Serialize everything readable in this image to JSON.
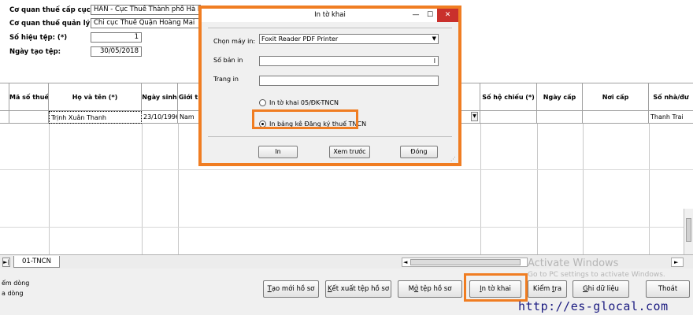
{
  "header": {
    "co_quan_cap_cuc_label": "Cơ quan thuế cấp cục:",
    "co_quan_cap_cuc_value": "HAN - Cục Thuế Thành phố Hà Nội",
    "co_quan_quan_ly_label": "Cơ quan thuế quản lý: (*)",
    "co_quan_quan_ly_value": "Chi cục Thuế Quận Hoàng Mai",
    "so_hieu_tep_label": "Số hiệu tệp: (*)",
    "so_hieu_tep_value": "1",
    "ngay_tao_tep_label": "Ngày tạo tệp:",
    "ngay_tao_tep_value": "30/05/2018"
  },
  "grid": {
    "columns": [
      "",
      "Mã số thuế",
      "Họ và tên (*)",
      "Ngày sinh",
      "Giới tí",
      "Số hộ chiếu (*)",
      "Ngày cấp",
      "Nơi cấp",
      "Số nhà/đư"
    ],
    "row": [
      "",
      "",
      "Trịnh Xuân Thanh",
      "23/10/1996",
      "Nam",
      "",
      "",
      "",
      "Thanh Trai"
    ]
  },
  "tabs": {
    "sheet": "01-TNCN",
    "nav_first": "|◄",
    "nav_next": "►|"
  },
  "status": {
    "line1": "ếm dòng",
    "line2": "a dòng"
  },
  "buttons": {
    "tao_moi_u": "T",
    "tao_moi_rest": "ạo mới hồ sơ",
    "ket_xuat_u": "K",
    "ket_xuat_rest": "ết xuất tệp hồ sơ",
    "mo_tep_pre": "M",
    "mo_tep_u": "ở",
    "mo_tep_rest": " tệp hồ sơ",
    "in_to_khai_u": "I",
    "in_to_khai_rest": "n tờ khai",
    "kiem_tra_pre": "Kiểm ",
    "kiem_tra_u": "t",
    "kiem_tra_rest": "ra",
    "ghi_du_lieu_u": "G",
    "ghi_du_lieu_rest": "hi dữ liệu",
    "thoat": "Thoát"
  },
  "watermark": {
    "title": "Activate Windows",
    "subtitle": "Go to PC settings to activate Windows."
  },
  "url": "http://es-glocal.com",
  "dialog": {
    "title": "In tờ khai",
    "minimize": "—",
    "maximize": "☐",
    "close": "✕",
    "chon_may_in_label": "Chọn máy in:",
    "chon_may_in_value": "Foxit Reader PDF Printer",
    "so_ban_in_label": "Số bản in",
    "so_ban_in_value": "l",
    "trang_in_label": "Trang in",
    "trang_in_value": "",
    "option1": "In tờ khai 05/ĐK-TNCN",
    "option2": "In bảng kê Đăng ký thuế TNCN",
    "btn_in": "In",
    "btn_xem_truoc": "Xem trước",
    "btn_dong": "Đóng"
  },
  "colors": {
    "highlight": "#f07d22",
    "close_button": "#c9302c",
    "url_text": "#1a1a80"
  }
}
